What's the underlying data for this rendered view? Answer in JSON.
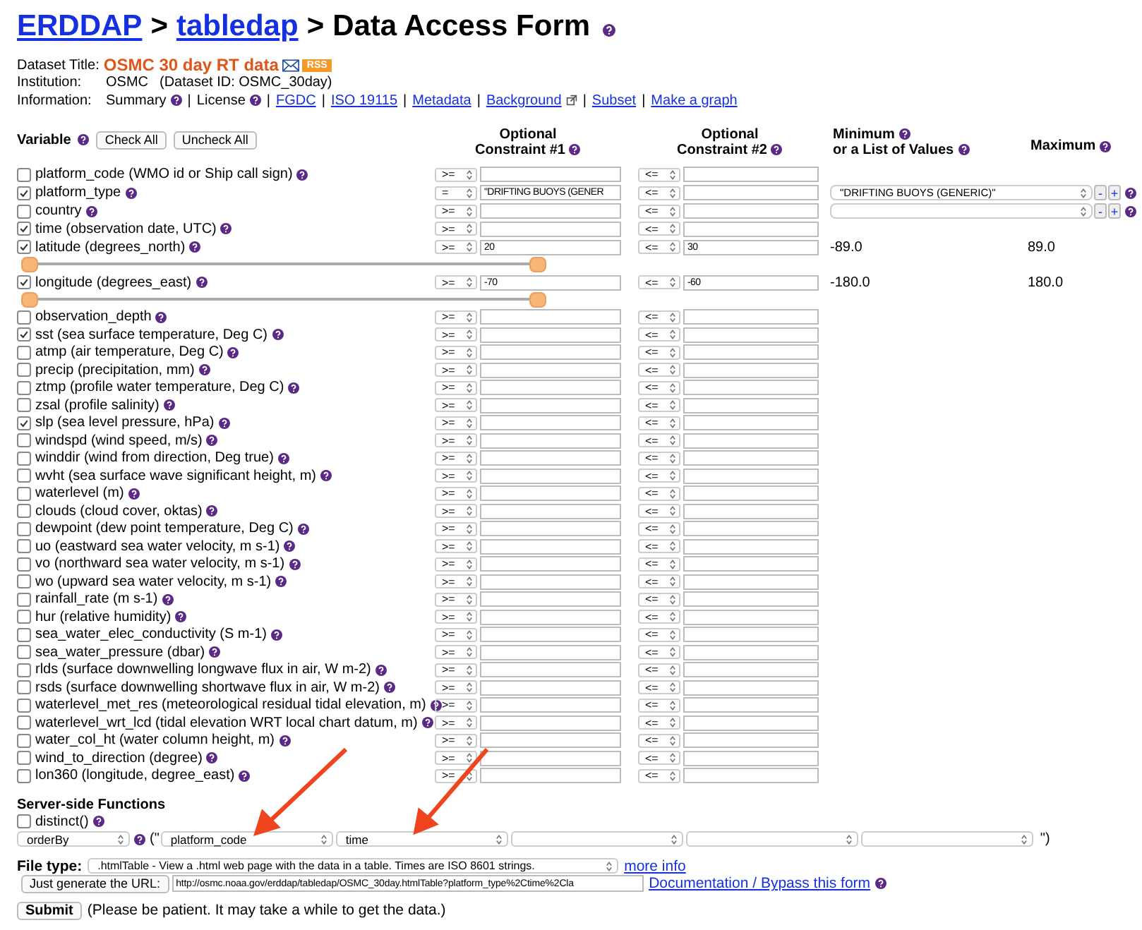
{
  "breadcrumb": [
    {
      "kind": "link",
      "text": "ERDDAP"
    },
    {
      "kind": "sep",
      "text": ">"
    },
    {
      "kind": "link",
      "text": "tabledap"
    },
    {
      "kind": "sep",
      "text": ">"
    },
    {
      "kind": "text",
      "text": "Data Access Form"
    }
  ],
  "info": {
    "title_label": "Dataset Title:",
    "title": "OSMC 30 day RT data",
    "rss": "RSS",
    "institution_label": "Institution:",
    "institution": "OSMC",
    "dataset_id": "(Dataset ID: OSMC_30day)",
    "information_label": "Information:",
    "items": [
      {
        "kind": "help",
        "text": "Summary"
      },
      {
        "kind": "sep",
        "text": "|"
      },
      {
        "kind": "help",
        "text": "License"
      },
      {
        "kind": "sep",
        "text": "|"
      },
      {
        "kind": "link",
        "text": "FGDC"
      },
      {
        "kind": "sep",
        "text": "|"
      },
      {
        "kind": "link",
        "text": "ISO 19115"
      },
      {
        "kind": "sep",
        "text": "|"
      },
      {
        "kind": "link",
        "text": "Metadata"
      },
      {
        "kind": "sep",
        "text": "|"
      },
      {
        "kind": "external",
        "text": "Background"
      },
      {
        "kind": "sep",
        "text": "|"
      },
      {
        "kind": "link",
        "text": "Subset"
      },
      {
        "kind": "sep",
        "text": "|"
      },
      {
        "kind": "link",
        "text": "Make a graph"
      }
    ]
  },
  "headers": {
    "variable": "Variable",
    "check_all": "Check All",
    "uncheck_all": "Uncheck All",
    "c1": [
      "Optional",
      "Constraint #1"
    ],
    "c2": [
      "Optional",
      "Constraint #2"
    ],
    "min": [
      "Minimum",
      "or a List of Values"
    ],
    "max": "Maximum"
  },
  "variables": [
    {
      "kind": "plain",
      "name": "platform_code (WMO id or Ship call sign)",
      "checked": false,
      "op1": ">=",
      "op2": "<="
    },
    {
      "kind": "list",
      "name": "platform_type",
      "checked": true,
      "op1": "=",
      "value1": "\"DRIFTING BUOYS (GENER",
      "op2": "<=",
      "list_value": "\"DRIFTING BUOYS (GENERIC)\"",
      "minus": "-",
      "plus": "+"
    },
    {
      "kind": "list",
      "name": "country",
      "checked": false,
      "op1": ">=",
      "op2": "<=",
      "minus": "-",
      "plus": "+"
    },
    {
      "kind": "plain",
      "name": "time (observation date, UTC)",
      "checked": true,
      "op1": ">=",
      "op2": "<="
    },
    {
      "kind": "range",
      "name": "latitude (degrees_north)",
      "checked": true,
      "op1": ">=",
      "value1": "20",
      "op2": "<=",
      "value2": "30",
      "min": "-89.0",
      "max": "89.0",
      "slider": {
        "level": 1
      }
    },
    {
      "kind": "range",
      "name": "longitude (degrees_east)",
      "checked": true,
      "op1": ">=",
      "value1": "-70",
      "op2": "<=",
      "value2": "-60",
      "min": "-180.0",
      "max": "180.0",
      "slider": {
        "level": 1
      }
    },
    {
      "kind": "plain",
      "name": "observation_depth",
      "checked": false,
      "op1": ">=",
      "op2": "<="
    },
    {
      "kind": "plain",
      "name": "sst (sea surface temperature, Deg C)",
      "checked": true,
      "op1": ">=",
      "op2": "<="
    },
    {
      "kind": "plain",
      "name": "atmp (air temperature, Deg C)",
      "checked": false,
      "op1": ">=",
      "op2": "<="
    },
    {
      "kind": "plain",
      "name": "precip (precipitation, mm)",
      "checked": false,
      "op1": ">=",
      "op2": "<="
    },
    {
      "kind": "plain",
      "name": "ztmp (profile water temperature, Deg C)",
      "checked": false,
      "op1": ">=",
      "op2": "<="
    },
    {
      "kind": "plain",
      "name": "zsal (profile salinity)",
      "checked": false,
      "op1": ">=",
      "op2": "<="
    },
    {
      "kind": "plain",
      "name": "slp (sea level pressure, hPa)",
      "checked": true,
      "op1": ">=",
      "op2": "<="
    },
    {
      "kind": "plain",
      "name": "windspd (wind speed, m/s)",
      "checked": false,
      "op1": ">=",
      "op2": "<="
    },
    {
      "kind": "plain",
      "name": "winddir (wind from direction, Deg true)",
      "checked": false,
      "op1": ">=",
      "op2": "<="
    },
    {
      "kind": "plain",
      "name": "wvht (sea surface wave significant height, m)",
      "checked": false,
      "op1": ">=",
      "op2": "<="
    },
    {
      "kind": "plain",
      "name": "waterlevel (m)",
      "checked": false,
      "op1": ">=",
      "op2": "<="
    },
    {
      "kind": "plain",
      "name": "clouds (cloud cover, oktas)",
      "checked": false,
      "op1": ">=",
      "op2": "<="
    },
    {
      "kind": "plain",
      "name": "dewpoint (dew point temperature, Deg C)",
      "checked": false,
      "op1": ">=",
      "op2": "<="
    },
    {
      "kind": "plain",
      "name": "uo (eastward sea water velocity, m s-1)",
      "checked": false,
      "op1": ">=",
      "op2": "<="
    },
    {
      "kind": "plain",
      "name": "vo (northward sea water velocity, m s-1)",
      "checked": false,
      "op1": ">=",
      "op2": "<="
    },
    {
      "kind": "plain",
      "name": "wo (upward sea water velocity, m s-1)",
      "checked": false,
      "op1": ">=",
      "op2": "<="
    },
    {
      "kind": "plain",
      "name": "rainfall_rate (m s-1)",
      "checked": false,
      "op1": ">=",
      "op2": "<="
    },
    {
      "kind": "plain",
      "name": "hur (relative humidity)",
      "checked": false,
      "op1": ">=",
      "op2": "<="
    },
    {
      "kind": "plain",
      "name": "sea_water_elec_conductivity (S m-1)",
      "checked": false,
      "op1": ">=",
      "op2": "<="
    },
    {
      "kind": "plain",
      "name": "sea_water_pressure (dbar)",
      "checked": false,
      "op1": ">=",
      "op2": "<="
    },
    {
      "kind": "plain",
      "name": "rlds (surface downwelling longwave flux in air, W m-2)",
      "checked": false,
      "op1": ">=",
      "op2": "<="
    },
    {
      "kind": "plain",
      "name": "rsds (surface downwelling shortwave flux in air, W m-2)",
      "checked": false,
      "op1": ">=",
      "op2": "<="
    },
    {
      "kind": "plain",
      "name": "waterlevel_met_res (meteorological residual tidal elevation, m)",
      "checked": false,
      "op1": ">=",
      "op2": "<="
    },
    {
      "kind": "plain",
      "name": "waterlevel_wrt_lcd (tidal elevation WRT local chart datum, m)",
      "checked": false,
      "op1": ">=",
      "op2": "<="
    },
    {
      "kind": "plain",
      "name": "water_col_ht (water column height, m)",
      "checked": false,
      "op1": ">=",
      "op2": "<="
    },
    {
      "kind": "plain",
      "name": "wind_to_direction (degree)",
      "checked": false,
      "op1": ">=",
      "op2": "<="
    },
    {
      "kind": "plain",
      "name": "lon360 (longitude, degree_east)",
      "checked": false,
      "op1": ">=",
      "op2": "<="
    }
  ],
  "server": {
    "heading": "Server-side Functions",
    "distinct": {
      "label": "distinct()",
      "checked": false
    },
    "function": "orderBy",
    "open": "(\"",
    "close": "\")",
    "fields": [
      {
        "kind": "value",
        "value": "platform_code"
      },
      {
        "kind": "value",
        "value": "time"
      },
      {
        "kind": "empty"
      },
      {
        "kind": "empty"
      },
      {
        "kind": "empty"
      }
    ]
  },
  "file_type": {
    "label": "File type:",
    "value": ".htmlTable - View a .html web page with the data in a table. Times are ISO 8601 strings.",
    "more": "more info"
  },
  "url": {
    "button": "Just generate the URL:",
    "value": "http://osmc.noaa.gov/erddap/tabledap/OSMC_30day.htmlTable?platform_type%2Ctime%2Cla",
    "link": "Documentation / Bypass this form"
  },
  "submit": {
    "button": "Submit",
    "note": "(Please be patient. It may take a while to get the data.)"
  }
}
